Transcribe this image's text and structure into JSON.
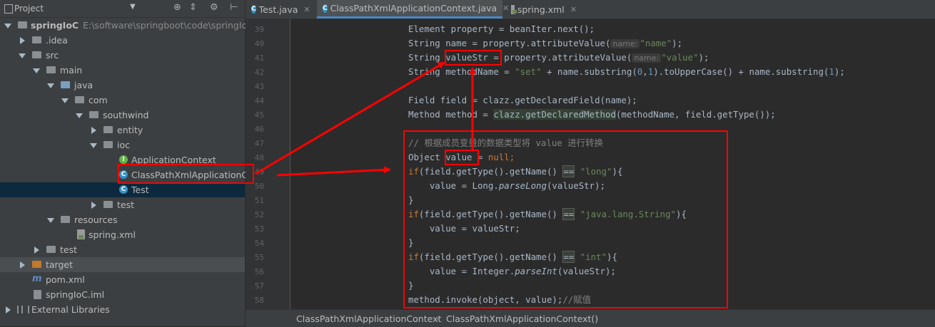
{
  "project_panel": {
    "title": "Project",
    "tree": [
      {
        "label": "springIoC",
        "path": "E:\\software\\springboot\\code\\springIoC"
      },
      {
        "label": ".idea"
      },
      {
        "label": "src"
      },
      {
        "label": "main"
      },
      {
        "label": "java"
      },
      {
        "label": "com"
      },
      {
        "label": "southwind"
      },
      {
        "label": "entity"
      },
      {
        "label": "ioc"
      },
      {
        "label": "ApplicationContext"
      },
      {
        "label": "ClassPathXmlApplicationContext"
      },
      {
        "label": "Test"
      },
      {
        "label": "test"
      },
      {
        "label": "resources"
      },
      {
        "label": "spring.xml"
      },
      {
        "label": "test"
      },
      {
        "label": "target"
      },
      {
        "label": "pom.xml"
      },
      {
        "label": "springIoC.iml"
      },
      {
        "label": "External Libraries"
      }
    ]
  },
  "tabs": [
    {
      "label": "Test.java",
      "active": false
    },
    {
      "label": "ClassPathXmlApplicationContext.java",
      "active": true
    },
    {
      "label": "spring.xml",
      "active": false
    }
  ],
  "editor": {
    "line_numbers": [
      "39",
      "40",
      "41",
      "42",
      "43",
      "44",
      "45",
      "46",
      "47",
      "48",
      "49",
      "50",
      "51",
      "52",
      "53",
      "54",
      "55",
      "56",
      "57",
      "58"
    ],
    "lines": {
      "l39": {
        "a": "Element property = beanIter.next();"
      },
      "l40": {
        "a": "String name = property.attributeValue(",
        "hint": "name:",
        "str": "\"name\"",
        "b": ");"
      },
      "l41": {
        "a": "String valueStr = property.attributeValue(",
        "hint": "name:",
        "str": "\"value\"",
        "b": ");"
      },
      "l42": {
        "a": "String methodName = ",
        "str": "\"set\"",
        "b": " + name.substring(",
        "n0": "0",
        "c": ",",
        "n1": "1",
        "d": ").toUpperCase() + name.substring(",
        "n2": "1",
        "e": ");"
      },
      "l44": {
        "a": "Field field = clazz.getDeclaredField(name);"
      },
      "l45": {
        "a": "Method method = ",
        "hl": "clazz.getDeclaredMethod",
        "b": "(methodName, field.getType());"
      },
      "l47": {
        "comment": "// 根据成员变量的数据类型将 value 进行转换"
      },
      "l48": {
        "a": "Object value = ",
        "kw": "null",
        "b": ";"
      },
      "l49": {
        "kw": "if",
        "a": "(field.getType().getName() ",
        "eq": "==",
        "str": " \"long\"",
        "b": "){"
      },
      "l50": {
        "a": "    value = Long.",
        "it": "parseLong",
        "b": "(valueStr);"
      },
      "l51": {
        "a": "}"
      },
      "l52": {
        "kw": "if",
        "a": "(field.getType().getName() ",
        "eq": "==",
        "str": " \"java.lang.String\"",
        "b": "){"
      },
      "l53": {
        "a": "    value = valueStr;"
      },
      "l54": {
        "a": "}"
      },
      "l55": {
        "kw": "if",
        "a": "(field.getType().getName() ",
        "eq": "==",
        "str": " \"int\"",
        "b": "){"
      },
      "l56": {
        "a": "    value = Integer.",
        "it": "parseInt",
        "b": "(valueStr);"
      },
      "l57": {
        "a": "}"
      },
      "l58": {
        "a": "method.invoke(object, value);",
        "comment": "//赋值"
      }
    }
  },
  "breadcrumb": {
    "items": [
      "ClassPathXmlApplicationContext",
      "ClassPathXmlApplicationContext()"
    ]
  },
  "colors": {
    "annotation": "#ff0000",
    "keyword": "#cc7832",
    "string": "#6a8759",
    "number": "#6897bb",
    "selection": "#0d293e"
  }
}
